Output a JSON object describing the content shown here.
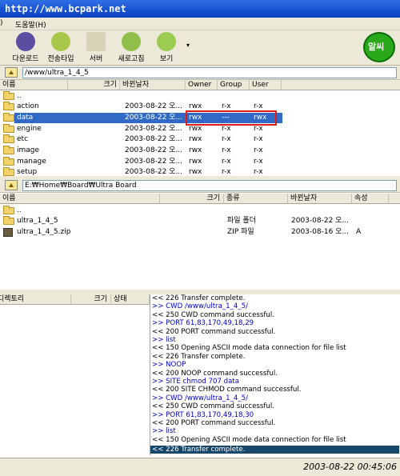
{
  "window": {
    "url_title": "http://www.bcpark.net"
  },
  "menu": {
    "paren": ")",
    "help": "도움말(H)"
  },
  "toolbar": {
    "buttons": [
      {
        "label": "다운로드",
        "icon": "download-icon"
      },
      {
        "label": "전송타입",
        "icon": "transfer-type-icon"
      },
      {
        "label": "서버",
        "icon": "server-icon"
      },
      {
        "label": "새로고침",
        "icon": "refresh-icon"
      },
      {
        "label": "보기",
        "icon": "view-icon"
      }
    ],
    "logo_text": "알씨"
  },
  "remote": {
    "path": "/www/ultra_1_4_5",
    "columns": [
      "이름",
      "크기",
      "바뀐날자",
      "Owner",
      "Group",
      "User"
    ],
    "files": [
      {
        "name": "..",
        "size": "",
        "date": "",
        "owner": "",
        "group": "",
        "user": ""
      },
      {
        "name": "action",
        "size": "",
        "date": "2003-08-22 오...",
        "owner": "rwx",
        "group": "r-x",
        "user": "r-x"
      },
      {
        "name": "data",
        "size": "",
        "date": "2003-08-22 오...",
        "owner": "rwx",
        "group": "---",
        "user": "rwx"
      },
      {
        "name": "engine",
        "size": "",
        "date": "2003-08-22 오...",
        "owner": "rwx",
        "group": "r-x",
        "user": "r-x"
      },
      {
        "name": "etc",
        "size": "",
        "date": "2003-08-22 오...",
        "owner": "rwx",
        "group": "r-x",
        "user": "r-x"
      },
      {
        "name": "image",
        "size": "",
        "date": "2003-08-22 오...",
        "owner": "rwx",
        "group": "r-x",
        "user": "r-x"
      },
      {
        "name": "manage",
        "size": "",
        "date": "2003-08-22 오...",
        "owner": "rwx",
        "group": "r-x",
        "user": "r-x"
      },
      {
        "name": "setup",
        "size": "",
        "date": "2003-08-22 오...",
        "owner": "rwx",
        "group": "r-x",
        "user": "r-x"
      }
    ],
    "selected_row": 2
  },
  "local": {
    "path": "E:₩Home₩Board₩Ultra Board",
    "columns": [
      "이름",
      "크기",
      "종류",
      "바뀐날자",
      "속성"
    ],
    "files": [
      {
        "name": "..",
        "size": "",
        "type": "",
        "date": "",
        "attr": "",
        "icon": "folder-icon"
      },
      {
        "name": "ultra_1_4_5",
        "size": "",
        "type": "파일 폴더",
        "date": "2003-08-22 오...",
        "attr": "",
        "icon": "folder-icon"
      },
      {
        "name": "ultra_1_4_5.zip",
        "size": "",
        "type": "ZIP 파일",
        "date": "2003-08-16 오...",
        "attr": "A",
        "icon": "zip-file-icon"
      }
    ]
  },
  "queue": {
    "columns": [
      "디렉토리",
      "크기",
      "상태"
    ]
  },
  "log": [
    {
      "kind": "r",
      "text": "<< 226 Transfer complete."
    },
    {
      "kind": "s",
      "text": ">> CWD /www/ultra_1_4_5/"
    },
    {
      "kind": "r",
      "text": "<< 250 CWD command successful."
    },
    {
      "kind": "s",
      "text": ">> PORT 61,83,170,49,18,29"
    },
    {
      "kind": "r",
      "text": "<< 200 PORT command successful."
    },
    {
      "kind": "s",
      "text": ">> list"
    },
    {
      "kind": "r",
      "text": "<< 150 Opening ASCII mode data connection for file list"
    },
    {
      "kind": "r",
      "text": "<< 226 Transfer complete."
    },
    {
      "kind": "s",
      "text": ">> NOOP"
    },
    {
      "kind": "r",
      "text": "<< 200 NOOP command successful."
    },
    {
      "kind": "s",
      "text": ">> SITE chmod 707 data"
    },
    {
      "kind": "r",
      "text": "<< 200 SITE CHMOD command successful."
    },
    {
      "kind": "s",
      "text": ">> CWD /www/ultra_1_4_5/"
    },
    {
      "kind": "r",
      "text": "<< 250 CWD command successful."
    },
    {
      "kind": "s",
      "text": ">> PORT 61,83,170,49,18,30"
    },
    {
      "kind": "r",
      "text": "<< 200 PORT command successful."
    },
    {
      "kind": "s",
      "text": ">> list"
    },
    {
      "kind": "r",
      "text": "<< 150 Opening ASCII mode data connection for file list"
    },
    {
      "kind": "last",
      "text": "<< 226 Transfer complete."
    }
  ],
  "status": {
    "datetime": "2003-08-22 00:45:06"
  }
}
